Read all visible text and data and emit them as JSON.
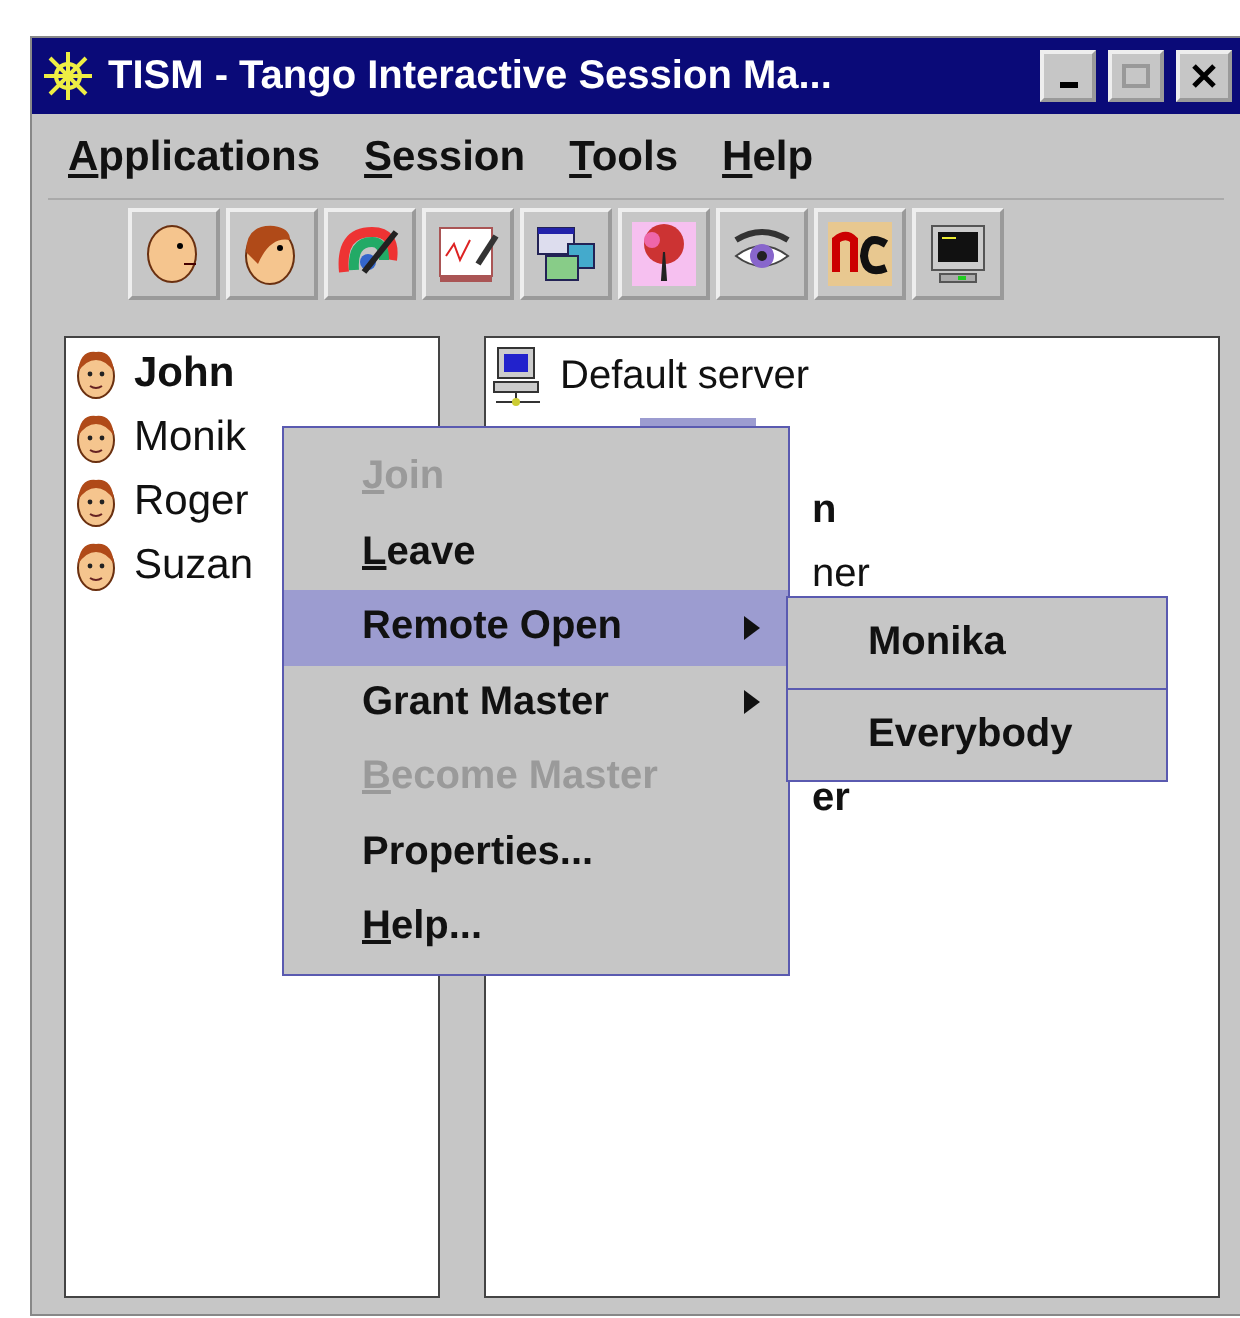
{
  "window": {
    "title": "TISM - Tango Interactive Session Ma..."
  },
  "menu_bar": [
    {
      "label": "Applications",
      "mnemonic": true
    },
    {
      "label": "Session",
      "mnemonic": true
    },
    {
      "label": "Tools",
      "mnemonic": true
    },
    {
      "label": "Help",
      "mnemonic": true
    }
  ],
  "toolbar": [
    {
      "kind": "bald-head"
    },
    {
      "kind": "head"
    },
    {
      "kind": "palette"
    },
    {
      "kind": "whiteboard"
    },
    {
      "kind": "windows"
    },
    {
      "kind": "tree"
    },
    {
      "kind": "eye"
    },
    {
      "kind": "nc"
    },
    {
      "kind": "monitor"
    }
  ],
  "participants": [
    {
      "name": "John",
      "bold": true
    },
    {
      "name": "Monik",
      "bold": false
    },
    {
      "name": "Roger",
      "bold": false
    },
    {
      "name": "Suzan",
      "bold": false
    }
  ],
  "tree": [
    {
      "kind": "server",
      "text": "Default server",
      "bold": false
    },
    {
      "kind": "selected"
    },
    {
      "kind": "fragment",
      "text": "n",
      "bold": true
    },
    {
      "kind": "fragment",
      "text": "ner",
      "bold": false
    },
    {
      "kind": "hidden"
    },
    {
      "kind": "hidden"
    },
    {
      "kind": "fragment",
      "text": "er",
      "bold": true
    }
  ],
  "context_menu": [
    {
      "label": "Join",
      "disabled": true,
      "mnemonic": true,
      "submenu": false,
      "selected": false
    },
    {
      "label": "Leave",
      "disabled": false,
      "mnemonic": true,
      "submenu": false,
      "selected": false
    },
    {
      "label": "Remote Open",
      "disabled": false,
      "mnemonic": false,
      "submenu": true,
      "selected": true
    },
    {
      "label": "Grant Master",
      "disabled": false,
      "mnemonic": false,
      "submenu": true,
      "selected": false
    },
    {
      "label": "Become Master",
      "disabled": true,
      "mnemonic": true,
      "submenu": false,
      "selected": false
    },
    {
      "label": "Properties...",
      "disabled": false,
      "mnemonic": false,
      "submenu": false,
      "selected": false
    },
    {
      "label": "Help...",
      "disabled": false,
      "mnemonic": true,
      "submenu": false,
      "selected": false
    }
  ],
  "submenu": [
    {
      "label": "Monika"
    },
    {
      "label": "Everybody"
    }
  ]
}
